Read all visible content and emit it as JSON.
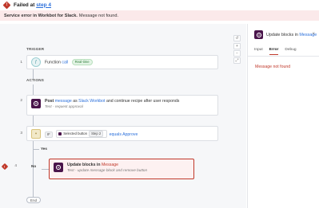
{
  "header": {
    "failed_prefix": "Failed at",
    "failed_step": "step 4"
  },
  "error_banner": {
    "bold": "Service error in Workbot for Slack.",
    "message": "Message not found."
  },
  "sections": {
    "trigger": "TRIGGER",
    "actions": "ACTIONS"
  },
  "steps": {
    "s1": {
      "num": "1",
      "app": "Function",
      "action": "call",
      "badge": "Real-time"
    },
    "s2": {
      "num": "2",
      "verb": "Post",
      "object": "message",
      "as": "as",
      "app": "Slack Workbot",
      "rest": "and continue recipe after user responds",
      "sub": "Test - request approval"
    },
    "s3": {
      "num": "3",
      "if": "IF",
      "pill": "Selected button",
      "pill_step": "Step 2",
      "op": "equals",
      "value": "Approve"
    },
    "s4": {
      "num": "4",
      "verb": "Update blocks in",
      "object": "Message",
      "sub": "Test - update message block and remove button"
    }
  },
  "branches": {
    "yes": "Yes",
    "no": "No"
  },
  "end_label": "End",
  "controls": {
    "reset": "↺",
    "zoom_in": "+",
    "zoom_out": "−",
    "fit": "⤢"
  },
  "panel": {
    "title_prefix": "Update blocks in",
    "title_object": "Message",
    "close": "×",
    "tabs": [
      "Input",
      "Error",
      "Debug"
    ],
    "active_tab": "Error",
    "error_text": "Message not found"
  },
  "colors": {
    "error": "#c0392b",
    "link": "#2a6fdb",
    "slack_purple": "#4a154b",
    "banner_bg": "#fbe9ea"
  }
}
